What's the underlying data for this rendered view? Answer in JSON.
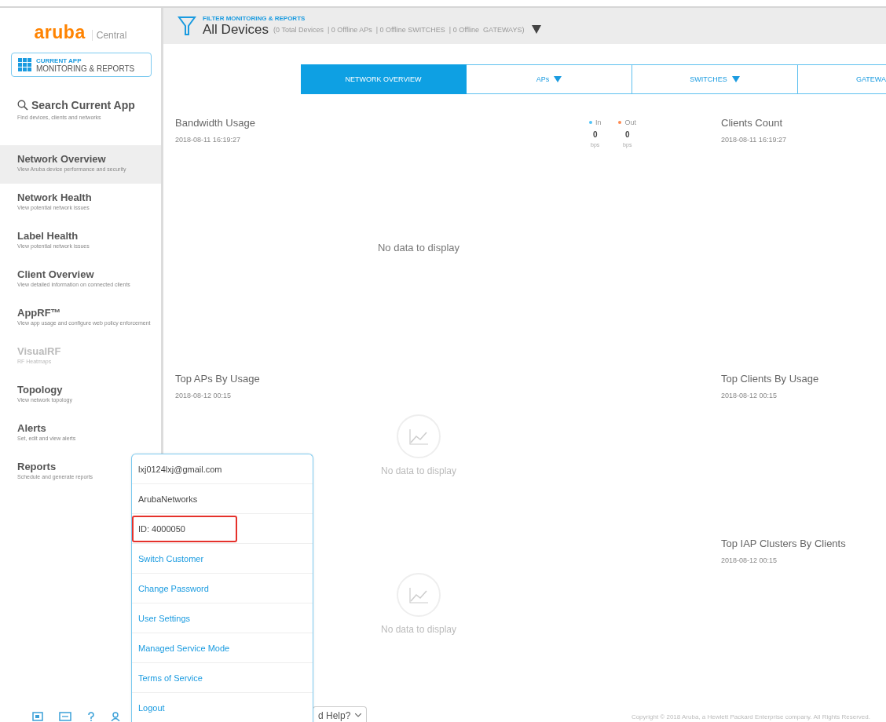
{
  "logo": {
    "brand": "aruba",
    "product": "Central"
  },
  "current_app": {
    "caption": "CURRENT APP",
    "name": "MONITORING & REPORTS"
  },
  "search": {
    "title": "Search Current App",
    "hint": "Find devices, clients and networks"
  },
  "nav": [
    {
      "title": "Network Overview",
      "subtitle": "View Aruba device performance and security",
      "selected": true,
      "disabled": false
    },
    {
      "title": "Network Health",
      "subtitle": "View potential network issues",
      "selected": false,
      "disabled": false
    },
    {
      "title": "Label Health",
      "subtitle": "View potential network issues",
      "selected": false,
      "disabled": false
    },
    {
      "title": "Client Overview",
      "subtitle": "View detailed information on connected clients",
      "selected": false,
      "disabled": false
    },
    {
      "title": "AppRF™",
      "subtitle": "View app usage and configure web policy enforcement",
      "selected": false,
      "disabled": false
    },
    {
      "title": "VisualRF",
      "subtitle": "RF Heatmaps",
      "selected": false,
      "disabled": true
    },
    {
      "title": "Topology",
      "subtitle": "View network topology",
      "selected": false,
      "disabled": false
    },
    {
      "title": "Alerts",
      "subtitle": "Set, edit and view alerts",
      "selected": false,
      "disabled": false
    },
    {
      "title": "Reports",
      "subtitle": "Schedule and generate reports",
      "selected": false,
      "disabled": false
    }
  ],
  "filter": {
    "caption": "FILTER MONITORING & REPORTS",
    "title": "All Devices",
    "summary": "(0 Total Devices  | 0 Offline APs  | 0 Offline SWITCHES  | 0 Offline  GATEWAYS)"
  },
  "tabs": [
    {
      "label": "NETWORK OVERVIEW",
      "selected": true,
      "dropdown": false
    },
    {
      "label": "APs",
      "selected": false,
      "dropdown": true
    },
    {
      "label": "SWITCHES",
      "selected": false,
      "dropdown": true
    },
    {
      "label": "GATEWA",
      "selected": false,
      "dropdown": false
    }
  ],
  "panels": [
    {
      "kind": "bandwidth",
      "title": "Bandwidth Usage",
      "timestamp": "2018-08-11 16:19:27",
      "empty_text": "No data to display",
      "legend": [
        {
          "label": "In",
          "color": "#4fc3f7",
          "value": "0",
          "unit": "bps"
        },
        {
          "label": "Out",
          "color": "#ff8a50",
          "value": "0",
          "unit": "bps"
        }
      ]
    },
    {
      "kind": "plain",
      "title": "Clients Count",
      "timestamp": "2018-08-11 16:19:27"
    },
    {
      "kind": "chart",
      "title": "Top APs By Usage",
      "timestamp": "2018-08-12 00:15",
      "empty_text": "No data to display"
    },
    {
      "kind": "plain",
      "title": "Top Clients By Usage",
      "timestamp": "2018-08-12 00:15"
    },
    {
      "kind": "chart",
      "empty_text": "No data to display"
    },
    {
      "kind": "plain",
      "title": "Top IAP Clusters By Clients",
      "timestamp": "2018-08-12 00:15"
    }
  ],
  "account_menu": [
    {
      "text": "lxj0124lxj@gmail.com",
      "kind": "info",
      "highlighted": false
    },
    {
      "text": "ArubaNetworks",
      "kind": "info",
      "highlighted": false
    },
    {
      "text": "ID: 4000050",
      "kind": "info",
      "highlighted": true
    },
    {
      "text": "Switch Customer",
      "kind": "link",
      "highlighted": false
    },
    {
      "text": "Change Password",
      "kind": "link",
      "highlighted": false
    },
    {
      "text": "User Settings",
      "kind": "link",
      "highlighted": false
    },
    {
      "text": "Managed Service Mode",
      "kind": "link",
      "highlighted": false
    },
    {
      "text": "Terms of Service",
      "kind": "link",
      "highlighted": false
    },
    {
      "text": "Logout",
      "kind": "link",
      "highlighted": false
    }
  ],
  "footer": {
    "help": "d Help?",
    "copyright": "Copyright © 2018 Aruba, a Hewlett Packard Enterprise company. All Rights Reserved."
  }
}
